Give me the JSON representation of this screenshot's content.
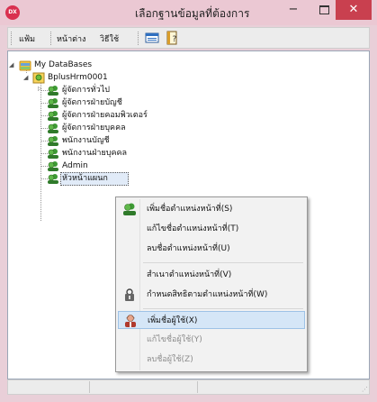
{
  "window": {
    "title": "เลือกฐานข้อมูลที่ต้องการ",
    "app_icon_text": "DX",
    "minimize": "−",
    "close": "✕"
  },
  "toolbar": {
    "menu_file": "แฟ้ม",
    "menu_window": "หน้าต่าง",
    "menu_howto": "วิธีใช้"
  },
  "tree": {
    "root": "My DataBases",
    "database": "BplusHrm0001",
    "positions": [
      "ผู้จัดการทั่วไป",
      "ผู้จัดการฝ่ายบัญชี",
      "ผู้จัดการฝ่ายคอมพิวเตอร์",
      "ผู้จัดการฝ่ายบุคคล",
      "พนักงานบัญชี",
      "พนักงานฝ่ายบุคคล",
      "Admin",
      "หัวหน้าแผนก"
    ]
  },
  "context_menu": {
    "add_position": "เพิ่มชื่อตำแหน่งหน้าที่(S)",
    "edit_position": "แก้ไขชื่อตำแหน่งหน้าที่(T)",
    "delete_position": "ลบชื่อตำแหน่งหน้าที่(U)",
    "copy_position": "สำเนาตำแหน่งหน้าที่(V)",
    "set_rights": "กำหนดสิทธิตามตำแหน่งหน้าที่(W)",
    "add_user": "เพิ่มชื่อผู้ใช้(X)",
    "edit_user": "แก้ไขชื่อผู้ใช้(Y)",
    "delete_user": "ลบชื่อผู้ใช้(Z)"
  }
}
